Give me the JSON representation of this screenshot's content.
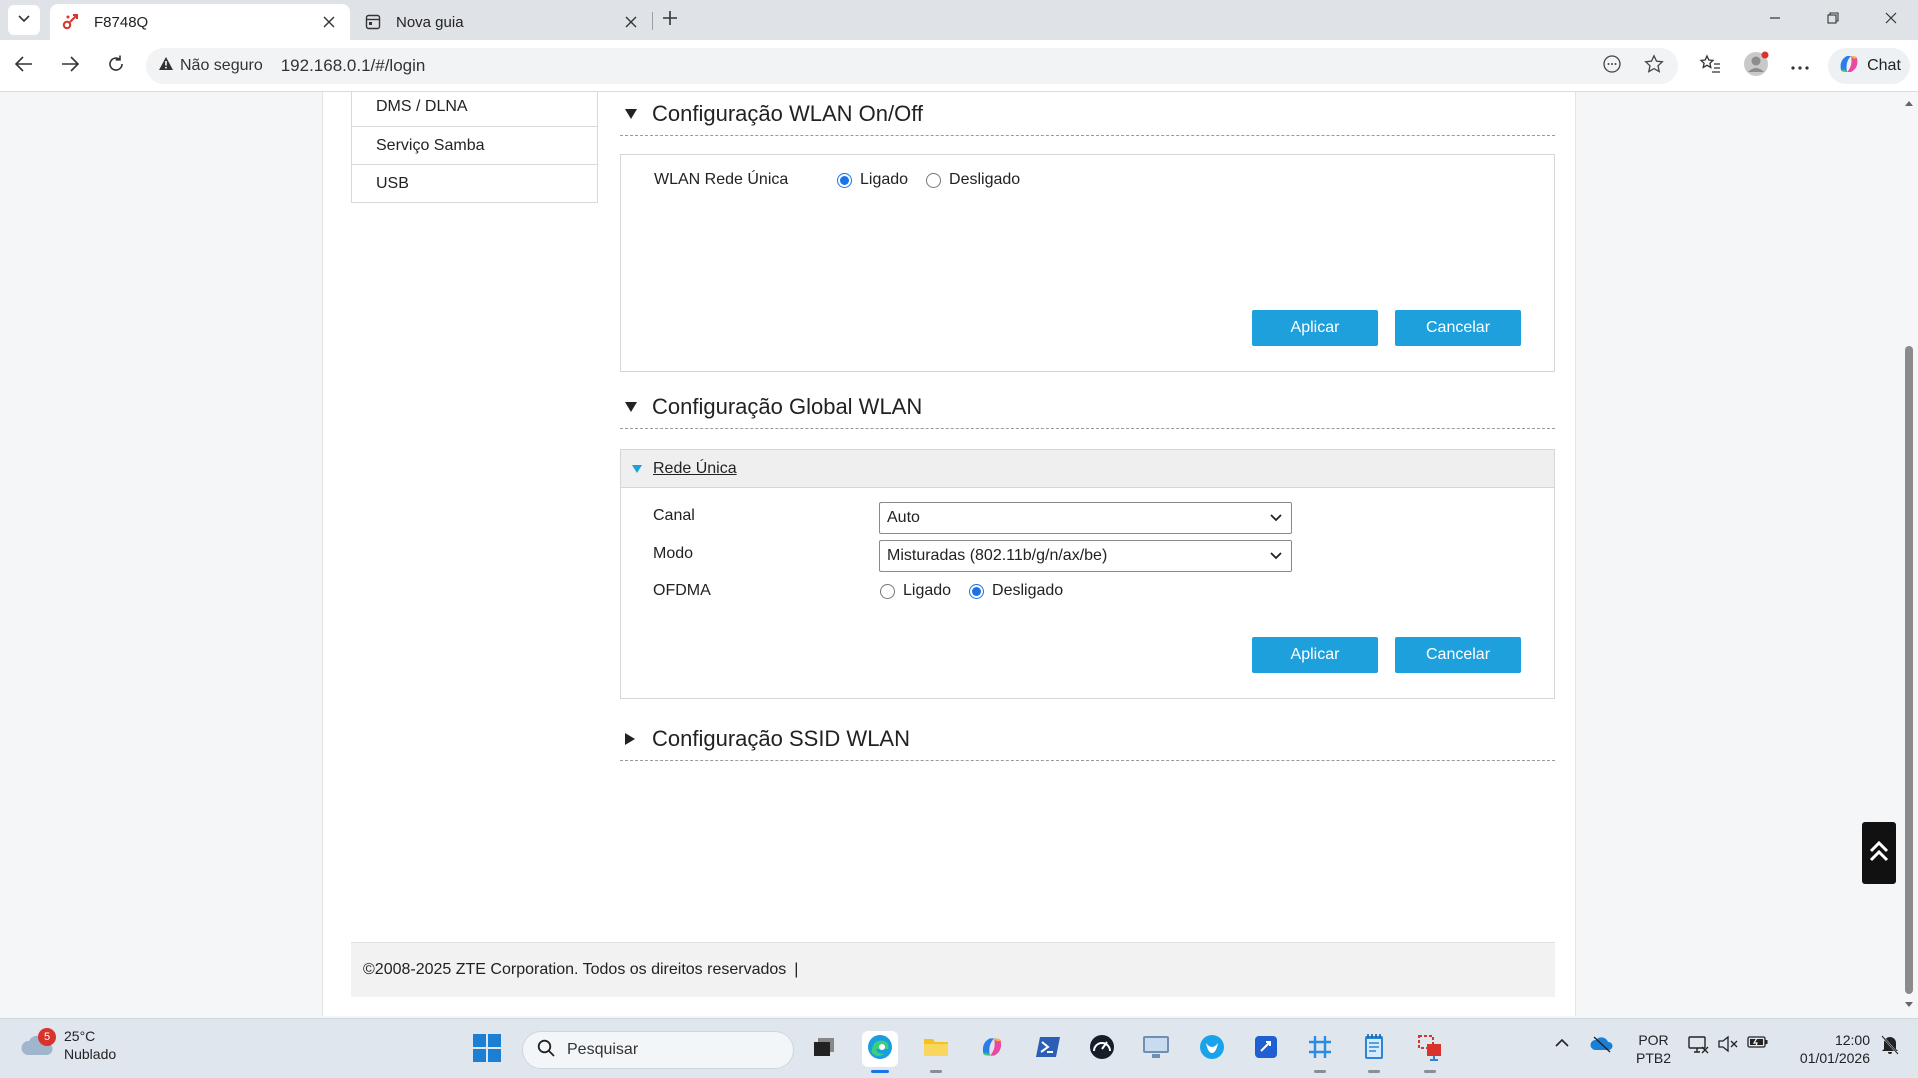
{
  "browser": {
    "tabs": [
      {
        "title": "F8748Q",
        "active": true
      },
      {
        "title": "Nova guia",
        "active": false
      }
    ],
    "address": {
      "security_label": "Não seguro",
      "url": "192.168.0.1/#/login"
    },
    "chat_label": "Chat"
  },
  "sidebar": {
    "items": [
      {
        "label": "DMS / DLNA"
      },
      {
        "label": "Serviço Samba"
      },
      {
        "label": "USB"
      }
    ]
  },
  "wlan_onoff": {
    "title": "Configuração WLAN On/Off",
    "field_label": "WLAN Rede Única",
    "options": [
      "Ligado",
      "Desligado"
    ],
    "selected": "Ligado",
    "apply_label": "Aplicar",
    "cancel_label": "Cancelar"
  },
  "wlan_global": {
    "title": "Configuração Global WLAN",
    "subsection_title": "Rede Única",
    "channel": {
      "label": "Canal",
      "value": "Auto"
    },
    "mode": {
      "label": "Modo",
      "value": "Misturadas (802.11b/g/n/ax/be)"
    },
    "ofdma": {
      "label": "OFDMA",
      "options": [
        "Ligado",
        "Desligado"
      ],
      "selected": "Desligado"
    },
    "apply_label": "Aplicar",
    "cancel_label": "Cancelar"
  },
  "wlan_ssid": {
    "title": "Configuração SSID WLAN"
  },
  "footer": {
    "copyright": "©2008-2025 ZTE Corporation. Todos os direitos reservados",
    "separator": "|"
  },
  "taskbar": {
    "weather": {
      "temp": "25°C",
      "condition": "Nublado",
      "badge": "5"
    },
    "search_placeholder": "Pesquisar",
    "language": {
      "line1": "POR",
      "line2": "PTB2"
    },
    "clock": {
      "time": "12:00",
      "date": "01/01/2026"
    }
  },
  "colors": {
    "accent_button": "#1ea0dc",
    "radio_selected": "#1a73e8"
  }
}
